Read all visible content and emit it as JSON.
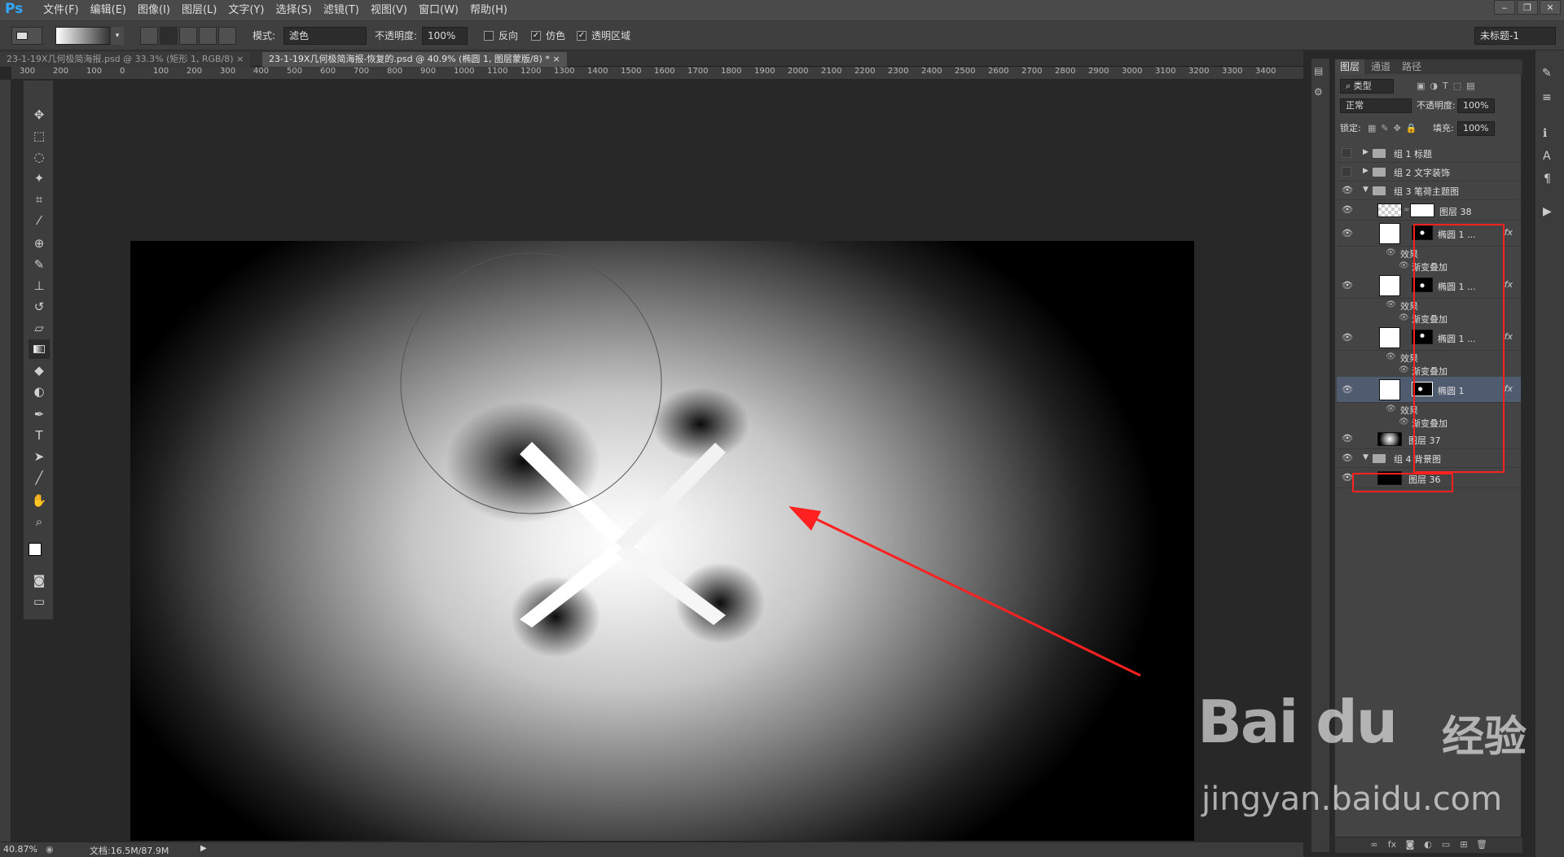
{
  "app": {
    "logo": "Ps"
  },
  "menu": [
    "文件(F)",
    "编辑(E)",
    "图像(I)",
    "图层(L)",
    "文字(Y)",
    "选择(S)",
    "滤镜(T)",
    "视图(V)",
    "窗口(W)",
    "帮助(H)"
  ],
  "window_controls": [
    "‒",
    "❐",
    "✕"
  ],
  "options": {
    "mode_label": "模式:",
    "mode_value": "滤色",
    "opacity_label": "不透明度:",
    "opacity_value": "100%",
    "reverse_label": "反向",
    "dither_label": "仿色",
    "transparency_label": "透明区域",
    "workspace": "未标题-1"
  },
  "tabs": [
    {
      "label": "23-1-19X几何极简海报.psd @ 33.3% (矩形 1, RGB/8)",
      "close": "×"
    },
    {
      "label": "23-1-19X几何极简海报-恢复的.psd @ 40.9% (椭圆 1, 图层蒙版/8) *",
      "close": "×"
    }
  ],
  "ruler_top": [
    "300",
    "200",
    "100",
    "0",
    "100",
    "200",
    "300",
    "400",
    "500",
    "600",
    "700",
    "800",
    "900",
    "1000",
    "1100",
    "1200",
    "1300",
    "1400",
    "1500",
    "1600",
    "1700",
    "1800",
    "1900",
    "2000",
    "2100",
    "2200",
    "2300",
    "2400",
    "2500",
    "2600",
    "2700",
    "2800",
    "2900",
    "3000",
    "3100",
    "3200",
    "3300",
    "3400"
  ],
  "status": {
    "zoom": "40.87%",
    "doc": "文档:16.5M/87.9M"
  },
  "layers_panel": {
    "tabs": [
      "图层",
      "通道",
      "路径"
    ],
    "filter_kind": "类型",
    "blend_mode": "正常",
    "opacity_label": "不透明度:",
    "opacity_value": "100%",
    "lock_label": "锁定:",
    "fill_label": "填充:",
    "fill_value": "100%",
    "groups": {
      "g1": "组 1 标题",
      "g2": "组 2 文字装饰",
      "g3": "组 3 笔荷主题图",
      "g4": "组 4 背景图"
    },
    "layers": {
      "l38": "图层 38",
      "e1": "椭圆 1 ...",
      "e2": "椭圆 1 ...",
      "e3": "椭圆 1 ...",
      "e4": "椭圆 1",
      "l37": "图层 37",
      "l36": "图层 36"
    },
    "effects_label": "效果",
    "gradient_overlay_label": "渐变叠加",
    "fx": "fx"
  },
  "watermark": {
    "logo": "Bai du",
    "jy": "经验",
    "url": "jingyan.baidu.com"
  }
}
